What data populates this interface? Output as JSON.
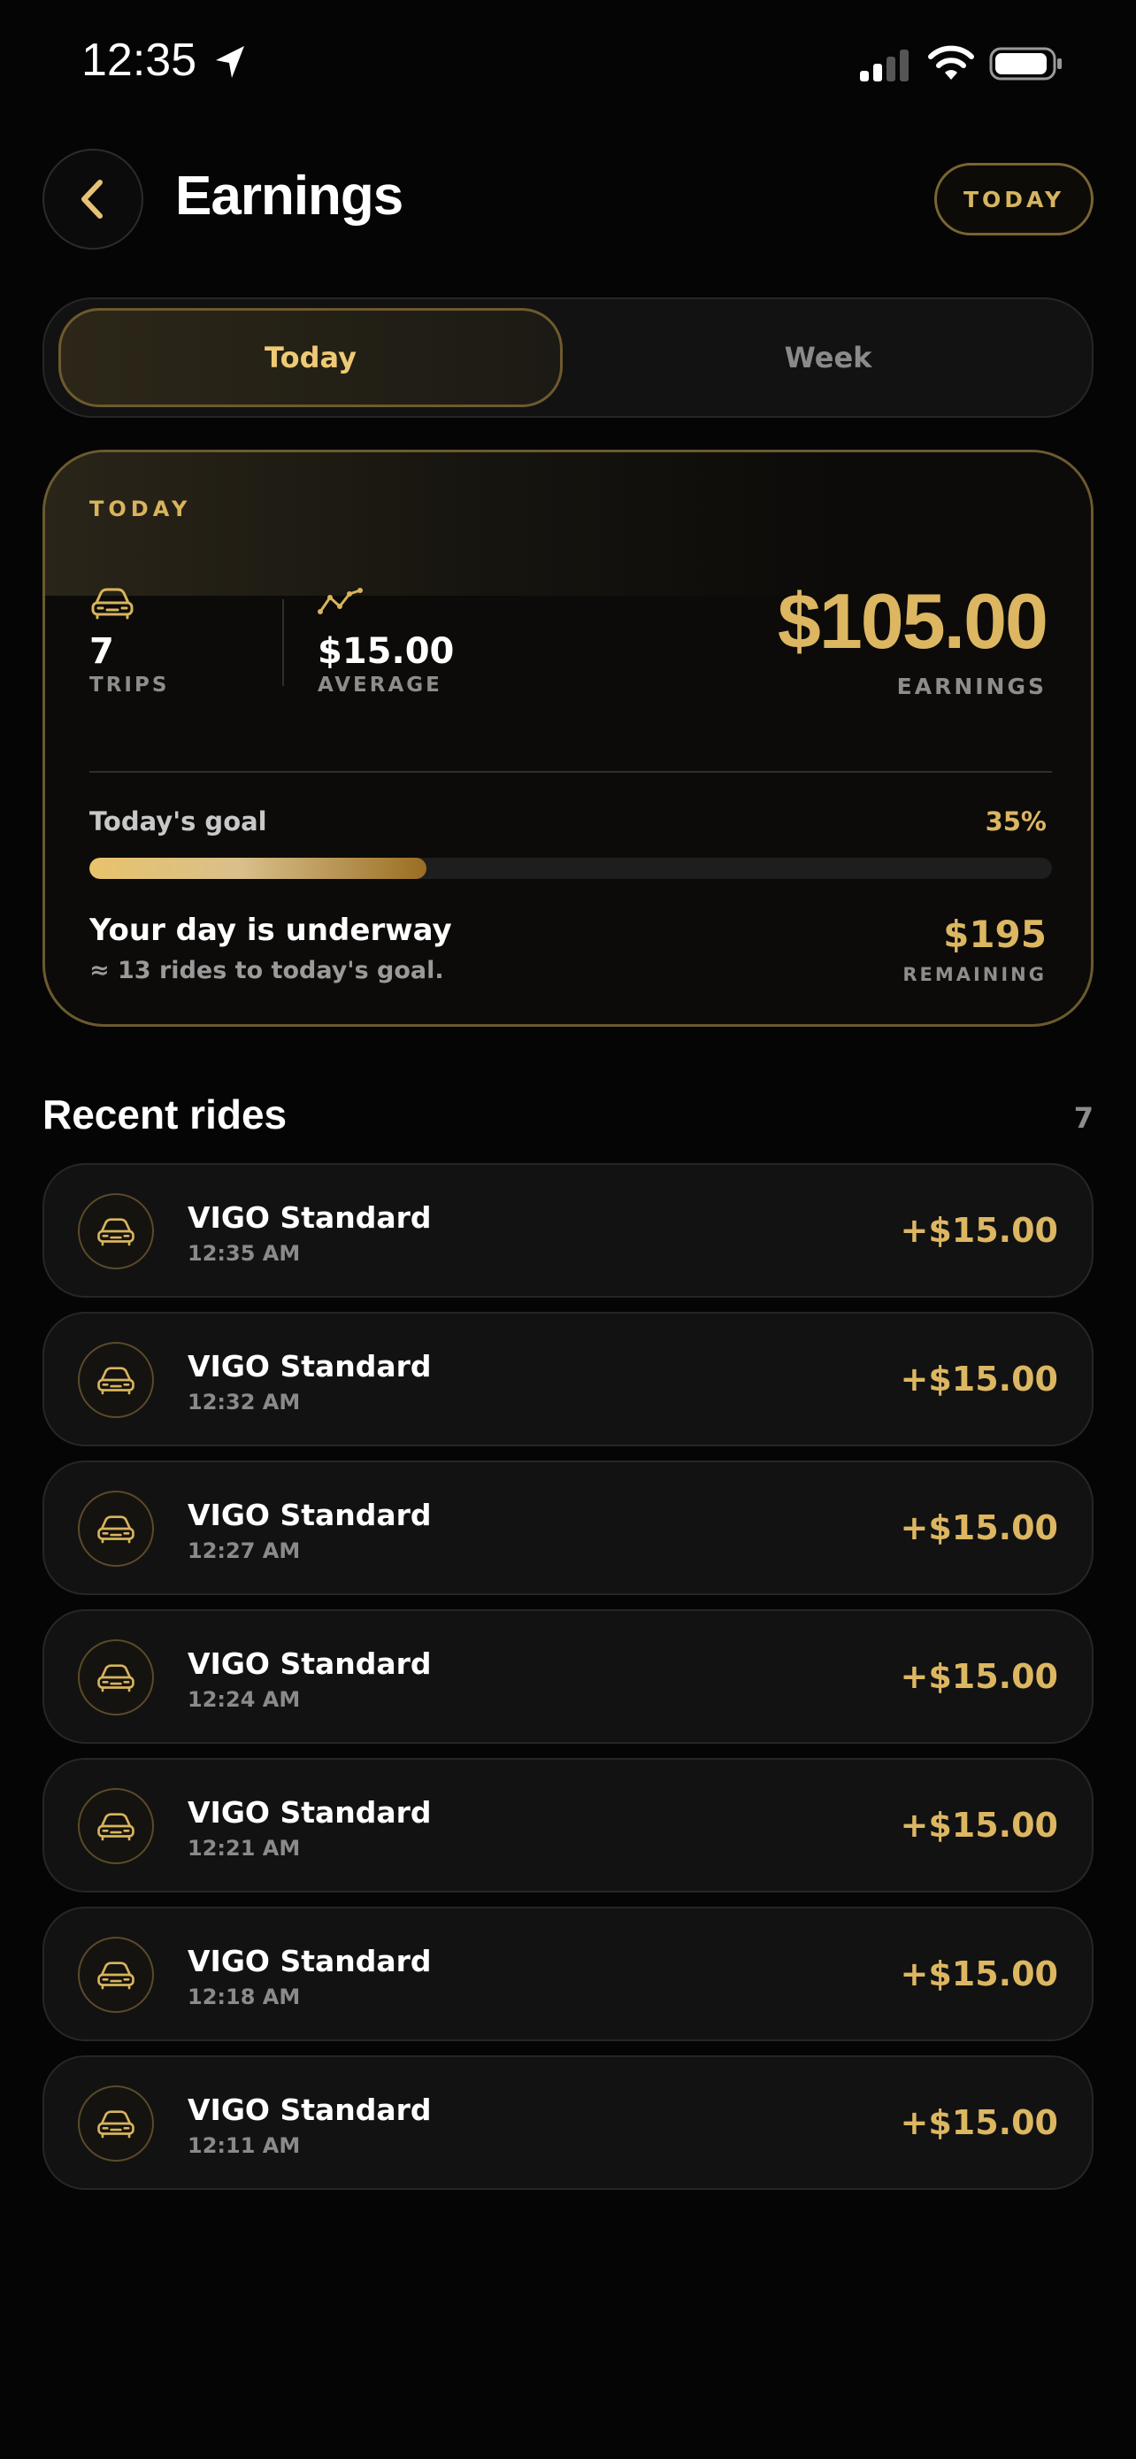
{
  "status_bar": {
    "time": "12:35"
  },
  "header": {
    "title": "Earnings",
    "period_pill": "TODAY"
  },
  "tabs": [
    {
      "label": "Today",
      "active": true
    },
    {
      "label": "Week",
      "active": false
    }
  ],
  "summary": {
    "card_label": "TODAY",
    "trips_value": "7",
    "trips_label": "TRIPS",
    "average_value": "$15.00",
    "average_label": "AVERAGE",
    "earnings_value": "$105.00",
    "earnings_label": "EARNINGS",
    "goal_label": "Today's goal",
    "goal_percent_text": "35%",
    "goal_progress": 0.35,
    "status_title": "Your day is underway",
    "status_sub": "≈ 13 rides to today's goal.",
    "remaining_value": "$195",
    "remaining_label": "REMAINING"
  },
  "recent": {
    "title": "Recent rides",
    "count": "7",
    "rides": [
      {
        "name": "VIGO Standard",
        "time": "12:35 AM",
        "amount": "+$15.00"
      },
      {
        "name": "VIGO Standard",
        "time": "12:32 AM",
        "amount": "+$15.00"
      },
      {
        "name": "VIGO Standard",
        "time": "12:27 AM",
        "amount": "+$15.00"
      },
      {
        "name": "VIGO Standard",
        "time": "12:24 AM",
        "amount": "+$15.00"
      },
      {
        "name": "VIGO Standard",
        "time": "12:21 AM",
        "amount": "+$15.00"
      },
      {
        "name": "VIGO Standard",
        "time": "12:18 AM",
        "amount": "+$15.00"
      },
      {
        "name": "VIGO Standard",
        "time": "12:11 AM",
        "amount": "+$15.00"
      }
    ]
  },
  "icons": {
    "back": "chevron-left-icon",
    "location": "location-arrow-icon",
    "signal": "cellular-signal-icon",
    "wifi": "wifi-icon",
    "battery": "battery-icon",
    "car": "car-icon",
    "trend": "trend-line-icon"
  },
  "colors": {
    "accent": "#dcb661",
    "background": "#050505",
    "card": "#121212",
    "muted": "#8d8d8d"
  }
}
